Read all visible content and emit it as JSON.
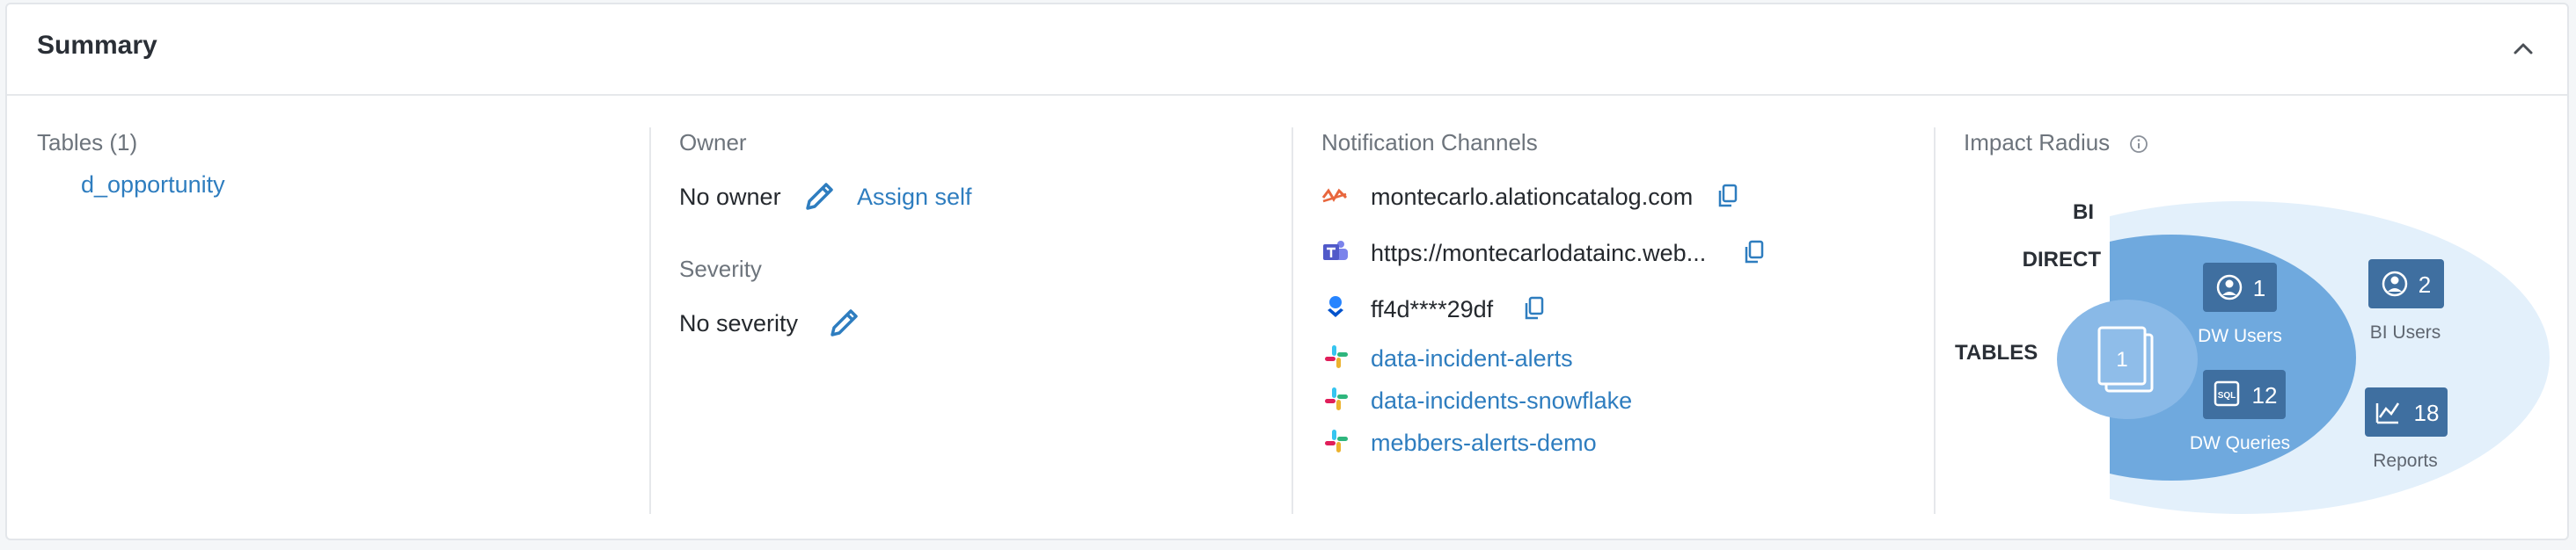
{
  "summary": {
    "title": "Summary"
  },
  "tables": {
    "label": "Tables (1)",
    "items": [
      "d_opportunity"
    ]
  },
  "owner": {
    "label": "Owner",
    "value": "No owner",
    "assign_label": "Assign self"
  },
  "severity": {
    "label": "Severity",
    "value": "No severity"
  },
  "notifications": {
    "label": "Notification Channels",
    "channels": [
      {
        "icon": "alation-icon",
        "text": "montecarlo.alationcatalog.com"
      },
      {
        "icon": "teams-icon",
        "text": "https://montecarlodatainc.web..."
      },
      {
        "icon": "opsgenie-icon",
        "text": "ff4d****29df"
      },
      {
        "icon": "slack-icon",
        "text": "data-incident-alerts"
      },
      {
        "icon": "slack-icon",
        "text": "data-incidents-snowflake"
      },
      {
        "icon": "slack-icon",
        "text": "mebbers-alerts-demo"
      }
    ]
  },
  "impact": {
    "label": "Impact Radius",
    "levels": {
      "bi": "BI",
      "direct": "DIRECT",
      "tables": "TABLES"
    },
    "tables_count": "1",
    "dw_users": {
      "count": "1",
      "label": "DW Users"
    },
    "dw_queries": {
      "count": "12",
      "label": "DW Queries"
    },
    "bi_users": {
      "count": "2",
      "label": "BI Users"
    },
    "reports": {
      "count": "18",
      "label": "Reports"
    }
  },
  "colors": {
    "link": "#2e7dbf",
    "outer_ellipse": "#e3f0fb",
    "mid_ellipse": "#6fa9de",
    "inner_ellipse": "#89b9e7",
    "badge_dark": "#3f6fa0"
  }
}
